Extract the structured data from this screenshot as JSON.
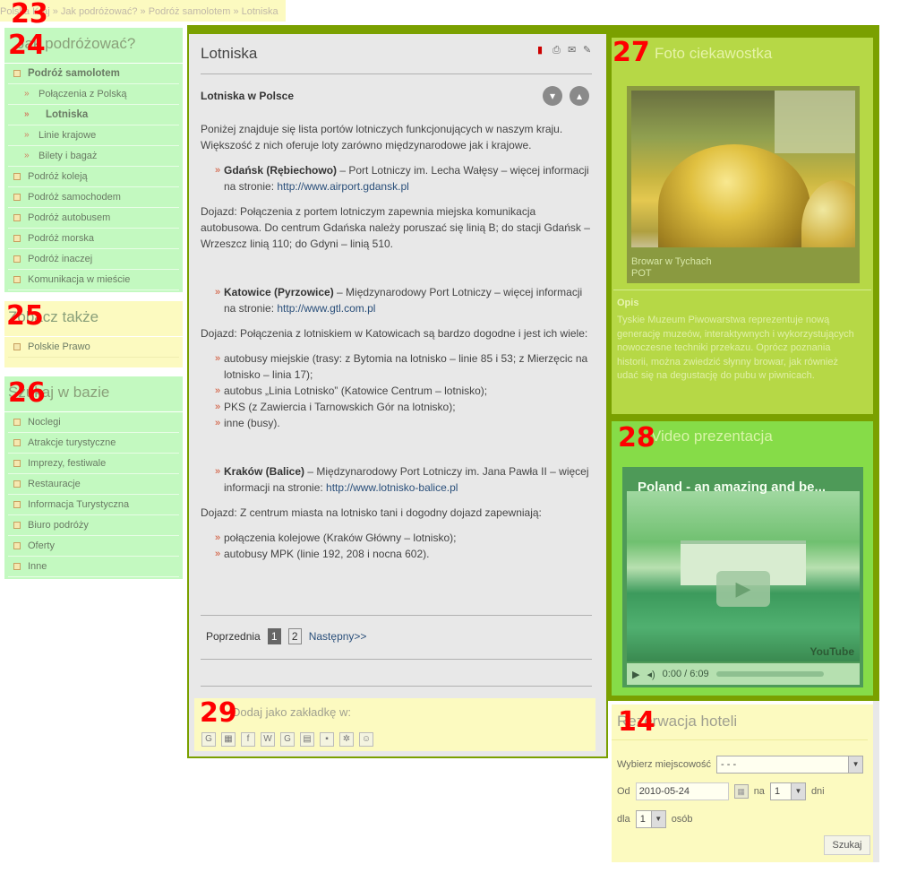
{
  "breadcrumb": {
    "text": "Polska Kraj » Jak podróżować? » Podróż samolotem » Lotniska"
  },
  "region_numbers": {
    "breadcrumb": "23",
    "nav": "24",
    "see_also": "25",
    "db": "26",
    "curiosity": "27",
    "video": "28",
    "bookmark": "29",
    "hotel": "14"
  },
  "nav": {
    "title": "Jak podróżować?",
    "items": [
      {
        "label": "Podróż samolotem"
      },
      {
        "label": "Połączenia z Polską"
      },
      {
        "label": "Lotniska"
      },
      {
        "label": "Linie krajowe"
      },
      {
        "label": "Bilety i bagaż"
      },
      {
        "label": "Podróż koleją"
      },
      {
        "label": "Podróż samochodem"
      },
      {
        "label": "Podróż autobusem"
      },
      {
        "label": "Podróż morska"
      },
      {
        "label": "Podróż inaczej"
      },
      {
        "label": "Komunikacja w mieście"
      }
    ]
  },
  "see_also": {
    "title": "Zobacz także",
    "items": [
      {
        "label": "Polskie Prawo"
      }
    ]
  },
  "db": {
    "title": "Szukaj w bazie",
    "items": [
      {
        "label": "Noclegi"
      },
      {
        "label": "Atrakcje turystyczne"
      },
      {
        "label": "Imprezy, festiwale"
      },
      {
        "label": "Restauracje"
      },
      {
        "label": "Informacja Turystyczna"
      },
      {
        "label": "Biuro podróży"
      },
      {
        "label": "Oferty"
      },
      {
        "label": "Inne"
      }
    ]
  },
  "content": {
    "title": "Lotniska",
    "subtitle": "Lotniska w Polsce",
    "intro": "Poniżej znajduje się lista portów lotniczych funkcjonujących w naszym kraju. Większość z nich oferuje loty zarówno międzynarodowe jak i krajowe.",
    "gdansk": {
      "name": "Gdańsk (Rębiechowo)",
      "text": " – Port Lotniczy im. Lecha Wałęsy – więcej informacji na stronie: ",
      "link": "http://www.airport.gdansk.pl",
      "access": "Dojazd: Połączenia z portem lotniczym zapewnia miejska komunikacja autobusowa. Do centrum Gdańska należy poruszać się linią B; do stacji Gdańsk – Wrzeszcz linią 110; do Gdyni – linią 510."
    },
    "katowice": {
      "name": "Katowice (Pyrzowice)",
      "text": " – Międzynarodowy Port Lotniczy – więcej informacji na stronie: ",
      "link": "http://www.gtl.com.pl",
      "access": "Dojazd: Połączenia z lotniskiem w Katowicach są bardzo dogodne i jest ich wiele:",
      "list": [
        "autobusy miejskie (trasy: z Bytomia na lotnisko – linie 85 i 53; z Mierzęcic na lotnisko – linia 17);",
        "autobus „Linia Lotnisko” (Katowice Centrum – lotnisko);",
        "PKS (z Zawiercia i Tarnowskich Gór na lotnisko);",
        "inne (busy)."
      ]
    },
    "krakow": {
      "name": "Kraków (Balice)",
      "text": " – Międzynarodowy Port Lotniczy im. Jana Pawła II – więcej informacji na stronie: ",
      "link": "http://www.lotnisko-balice.pl",
      "access": "Dojazd: Z centrum miasta na lotnisko tani i dogodny dojazd zapewniają:",
      "list": [
        "połączenia kolejowe (Kraków Główny – lotnisko);",
        "autobusy MPK (linie 192, 208 i nocna 602)."
      ]
    },
    "pager": {
      "prev": "Poprzednia",
      "pages": [
        "1",
        "2"
      ],
      "next": "Następny>>"
    }
  },
  "bookmark": {
    "title": "Dodaj jako zakładkę w:"
  },
  "curiosity": {
    "title": "Foto ciekawostka",
    "caption_line1": "Browar w Tychach",
    "caption_line2": "POT",
    "opis_title": "Opis",
    "opis_text": "Tyskie Muzeum Piwowarstwa reprezentuje nową generację muzeów, interaktywnych i wykorzystujących nowoczesne techniki przekazu. Oprócz poznania historii, można zwiedzić słynny browar, jak również udać się na degustację do pubu w piwnicach."
  },
  "video": {
    "title": "Video prezentacja",
    "player_title": "Poland - an amazing and be...",
    "time": "0:00 / 6:09",
    "brand": "YouTube"
  },
  "hotel": {
    "title": "Rezerwacja hoteli",
    "city_label": "Wybierz miejscowość",
    "city_value": "- - -",
    "from_label": "Od",
    "date": "2010-05-24",
    "na_label": "na",
    "days_value": "1",
    "days_label": "dni",
    "for_label": "dla",
    "persons_value": "1",
    "persons_label": "osób",
    "search": "Szukaj"
  }
}
